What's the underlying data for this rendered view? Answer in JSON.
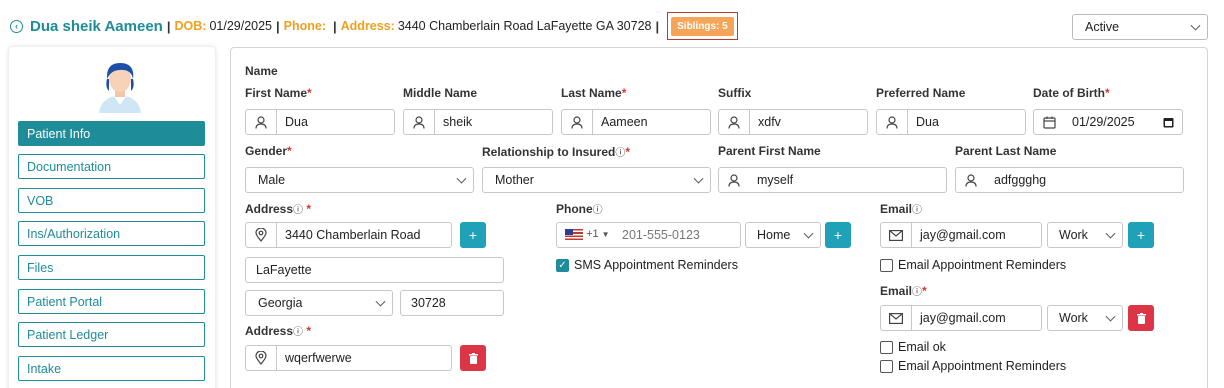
{
  "header": {
    "patient_name": "Dua sheik Aameen",
    "dob_label": "DOB:",
    "dob_value": "01/29/2025",
    "phone_label": "Phone:",
    "phone_value": "",
    "address_label": "Address:",
    "address_value": "3440 Chamberlain Road LaFayette GA 30728",
    "siblings_badge": "Siblings: 5",
    "status_value": "Active"
  },
  "sidebar": {
    "items": [
      {
        "label": "Patient Info",
        "active": true
      },
      {
        "label": "Documentation"
      },
      {
        "label": "VOB"
      },
      {
        "label": "Ins/Authorization"
      },
      {
        "label": "Files"
      },
      {
        "label": "Patient Portal"
      },
      {
        "label": "Patient Ledger"
      },
      {
        "label": "Intake"
      }
    ]
  },
  "form": {
    "section_name": "Name",
    "first_name_label": "First Name",
    "first_name": "Dua",
    "middle_name_label": "Middle Name",
    "middle_name": "sheik",
    "last_name_label": "Last Name",
    "last_name": "Aameen",
    "suffix_label": "Suffix",
    "suffix": "xdfv",
    "preferred_name_label": "Preferred Name",
    "preferred_name": "Dua",
    "dob_label": "Date of Birth",
    "dob": "01/29/2025",
    "gender_label": "Gender",
    "gender": "Male",
    "relationship_label": "Relationship to Insured",
    "relationship": "Mother",
    "parent_first_label": "Parent First Name",
    "parent_first": "myself",
    "parent_last_label": "Parent Last Name",
    "parent_last": "adfggghg",
    "address_label": "Address",
    "address_line": "3440 Chamberlain Road",
    "city": "LaFayette",
    "state": "Georgia",
    "zip": "30728",
    "address2_label": "Address",
    "address2_line": "wqerfwerwe",
    "phone_label": "Phone",
    "phone_code": "+1",
    "phone_placeholder": "201-555-0123",
    "phone_type": "Home",
    "sms_label": "SMS Appointment Reminders",
    "email_label": "Email",
    "email1": "jay@gmail.com",
    "email1_type": "Work",
    "email_reminders_label": "Email Appointment Reminders",
    "email2_label": "Email",
    "email2": "jay@gmail.com",
    "email2_type": "Work",
    "email_ok_label": "Email ok",
    "email2_reminders_label": "Email Appointment Reminders"
  },
  "colors": {
    "accent": "#1e8c99",
    "orange": "#f0a020",
    "danger": "#dc3545"
  }
}
